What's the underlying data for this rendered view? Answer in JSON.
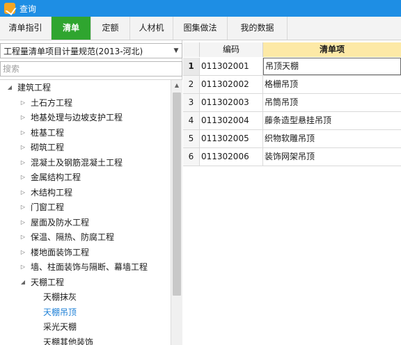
{
  "window": {
    "title": "查询",
    "icon": "app-logo-icon",
    "title_bar_color": "#1e8ee4"
  },
  "tabs": [
    {
      "label": "清单指引",
      "active": false
    },
    {
      "label": "清单",
      "active": true
    },
    {
      "label": "定额",
      "active": false
    },
    {
      "label": "人材机",
      "active": false
    },
    {
      "label": "图集做法",
      "active": false
    },
    {
      "label": "我的数据",
      "active": false
    }
  ],
  "active_tab_color": "#2fa52f",
  "left": {
    "spec_select": {
      "value": "工程量清单项目计量规范(2013-河北)"
    },
    "search": {
      "placeholder": "搜索"
    },
    "tree": [
      {
        "label": "建筑工程",
        "level": 0,
        "expanded": true
      },
      {
        "label": "土石方工程",
        "level": 1,
        "expanded": false
      },
      {
        "label": "地基处理与边坡支护工程",
        "level": 1,
        "expanded": false
      },
      {
        "label": "桩基工程",
        "level": 1,
        "expanded": false
      },
      {
        "label": "砌筑工程",
        "level": 1,
        "expanded": false
      },
      {
        "label": "混凝土及钢筋混凝土工程",
        "level": 1,
        "expanded": false
      },
      {
        "label": "金属结构工程",
        "level": 1,
        "expanded": false
      },
      {
        "label": "木结构工程",
        "level": 1,
        "expanded": false
      },
      {
        "label": "门窗工程",
        "level": 1,
        "expanded": false
      },
      {
        "label": "屋面及防水工程",
        "level": 1,
        "expanded": false
      },
      {
        "label": "保温、隔热、防腐工程",
        "level": 1,
        "expanded": false
      },
      {
        "label": "楼地面装饰工程",
        "level": 1,
        "expanded": false
      },
      {
        "label": "墙、柱面装饰与隔断、幕墙工程",
        "level": 1,
        "expanded": false
      },
      {
        "label": "天棚工程",
        "level": 1,
        "expanded": true
      },
      {
        "label": "天棚抹灰",
        "level": 2
      },
      {
        "label": "天棚吊顶",
        "level": 2,
        "selected": true
      },
      {
        "label": "采光天棚",
        "level": 2
      },
      {
        "label": "天棚其他装饰",
        "level": 2
      }
    ]
  },
  "grid": {
    "columns": {
      "index": "",
      "code": "编码",
      "name": "清单项"
    },
    "header_highlight_color": "#fde9a6",
    "rows": [
      {
        "index": "1",
        "code": "011302001",
        "name": "吊顶天棚",
        "current": true
      },
      {
        "index": "2",
        "code": "011302002",
        "name": "格栅吊顶"
      },
      {
        "index": "3",
        "code": "011302003",
        "name": "吊筒吊顶"
      },
      {
        "index": "4",
        "code": "011302004",
        "name": "藤条造型悬挂吊顶"
      },
      {
        "index": "5",
        "code": "011302005",
        "name": "织物软雕吊顶"
      },
      {
        "index": "6",
        "code": "011302006",
        "name": "装饰网架吊顶"
      }
    ]
  }
}
